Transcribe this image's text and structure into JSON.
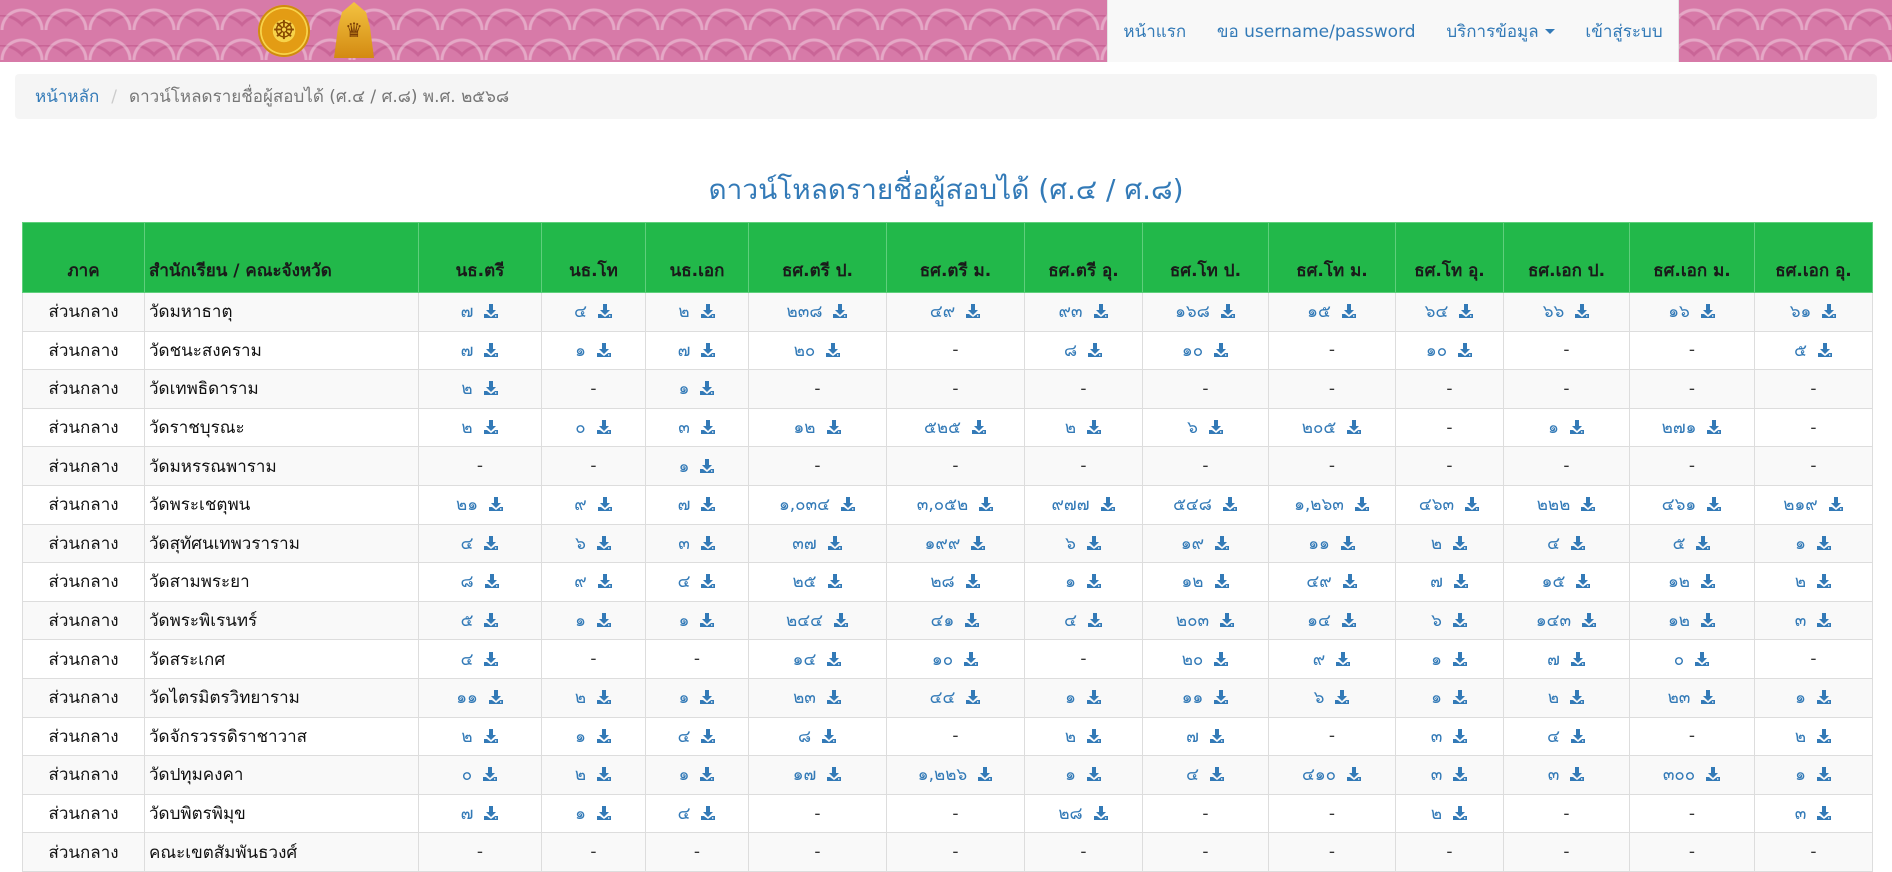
{
  "nav": {
    "items": [
      "หน้าแรก",
      "ขอ username/password",
      "บริการข้อมูล",
      "เข้าสู่ระบบ"
    ]
  },
  "breadcrumb": {
    "home": "หน้าหลัก",
    "current": "ดาวน์โหลดรายชื่อผู้สอบได้ (ศ.๔ / ศ.๘) พ.ศ. ๒๕๖๘"
  },
  "page": {
    "title": "ดาวน์โหลดรายชื่อผู้สอบได้ (ศ.๔ / ศ.๘)"
  },
  "colors": {
    "header_green": "#22b84a",
    "link_blue": "#337ab7",
    "banner_pink": "#d77aa8"
  },
  "table": {
    "headers": [
      "ภาค",
      "สำนักเรียน / คณะจังหวัด",
      "นธ.ตรี",
      "นธ.โท",
      "นธ.เอก",
      "ธศ.ตรี ป.",
      "ธศ.ตรี ม.",
      "ธศ.ตรี อุ.",
      "ธศ.โท ป.",
      "ธศ.โท ม.",
      "ธศ.โท อุ.",
      "ธศ.เอก ป.",
      "ธศ.เอก ม.",
      "ธศ.เอก อุ."
    ],
    "rows": [
      [
        "ส่วนกลาง",
        "วัดมหาธาตุ",
        "๗",
        "๔",
        "๒",
        "๒๓๘",
        "๔๙",
        "๙๓",
        "๑๖๘",
        "๑๕",
        "๖๔",
        "๖๖",
        "๑๖",
        "๖๑"
      ],
      [
        "ส่วนกลาง",
        "วัดชนะสงคราม",
        "๗",
        "๑",
        "๗",
        "๒๐",
        "-",
        "๘",
        "๑๐",
        "-",
        "๑๐",
        "-",
        "-",
        "๕"
      ],
      [
        "ส่วนกลาง",
        "วัดเทพธิดาราม",
        "๒",
        "-",
        "๑",
        "-",
        "-",
        "-",
        "-",
        "-",
        "-",
        "-",
        "-",
        "-"
      ],
      [
        "ส่วนกลาง",
        "วัดราชบุรณะ",
        "๒",
        "๐",
        "๓",
        "๑๒",
        "๕๒๕",
        "๒",
        "๖",
        "๒๐๕",
        "-",
        "๑",
        "๒๗๑",
        "-"
      ],
      [
        "ส่วนกลาง",
        "วัดมหรรณพาราม",
        "-",
        "-",
        "๑",
        "-",
        "-",
        "-",
        "-",
        "-",
        "-",
        "-",
        "-",
        "-"
      ],
      [
        "ส่วนกลาง",
        "วัดพระเชตุพน",
        "๒๑",
        "๙",
        "๗",
        "๑,๐๓๔",
        "๓,๐๕๒",
        "๙๗๗",
        "๕๔๘",
        "๑,๒๖๓",
        "๔๖๓",
        "๒๒๒",
        "๔๖๑",
        "๒๑๙"
      ],
      [
        "ส่วนกลาง",
        "วัดสุทัศนเทพวราราม",
        "๔",
        "๖",
        "๓",
        "๓๗",
        "๑๙๙",
        "๖",
        "๑๙",
        "๑๑",
        "๒",
        "๔",
        "๕",
        "๑"
      ],
      [
        "ส่วนกลาง",
        "วัดสามพระยา",
        "๘",
        "๙",
        "๔",
        "๒๕",
        "๒๘",
        "๑",
        "๑๒",
        "๔๙",
        "๗",
        "๑๕",
        "๑๒",
        "๒"
      ],
      [
        "ส่วนกลาง",
        "วัดพระพิเรนทร์",
        "๕",
        "๑",
        "๑",
        "๒๔๔",
        "๔๑",
        "๔",
        "๒๐๓",
        "๑๔",
        "๖",
        "๑๔๓",
        "๑๒",
        "๓"
      ],
      [
        "ส่วนกลาง",
        "วัดสระเกศ",
        "๔",
        "-",
        "-",
        "๑๔",
        "๑๐",
        "-",
        "๒๐",
        "๙",
        "๑",
        "๗",
        "๐",
        "-"
      ],
      [
        "ส่วนกลาง",
        "วัดไตรมิตรวิทยาราม",
        "๑๑",
        "๒",
        "๑",
        "๒๓",
        "๔๔",
        "๑",
        "๑๑",
        "๖",
        "๑",
        "๒",
        "๒๓",
        "๑"
      ],
      [
        "ส่วนกลาง",
        "วัดจักรวรรดิราชาวาส",
        "๒",
        "๑",
        "๔",
        "๘",
        "-",
        "๒",
        "๗",
        "-",
        "๓",
        "๔",
        "-",
        "๒"
      ],
      [
        "ส่วนกลาง",
        "วัดปทุมคงคา",
        "๐",
        "๒",
        "๑",
        "๑๗",
        "๑,๒๒๖",
        "๑",
        "๔",
        "๔๑๐",
        "๓",
        "๓",
        "๓๐๐",
        "๑"
      ],
      [
        "ส่วนกลาง",
        "วัดบพิตรพิมุข",
        "๗",
        "๑",
        "๔",
        "-",
        "-",
        "๒๘",
        "-",
        "-",
        "๒",
        "-",
        "-",
        "๓"
      ],
      [
        "ส่วนกลาง",
        "คณะเขตสัมพันธวงศ์",
        "-",
        "-",
        "-",
        "-",
        "-",
        "-",
        "-",
        "-",
        "-",
        "-",
        "-",
        "-"
      ]
    ]
  }
}
